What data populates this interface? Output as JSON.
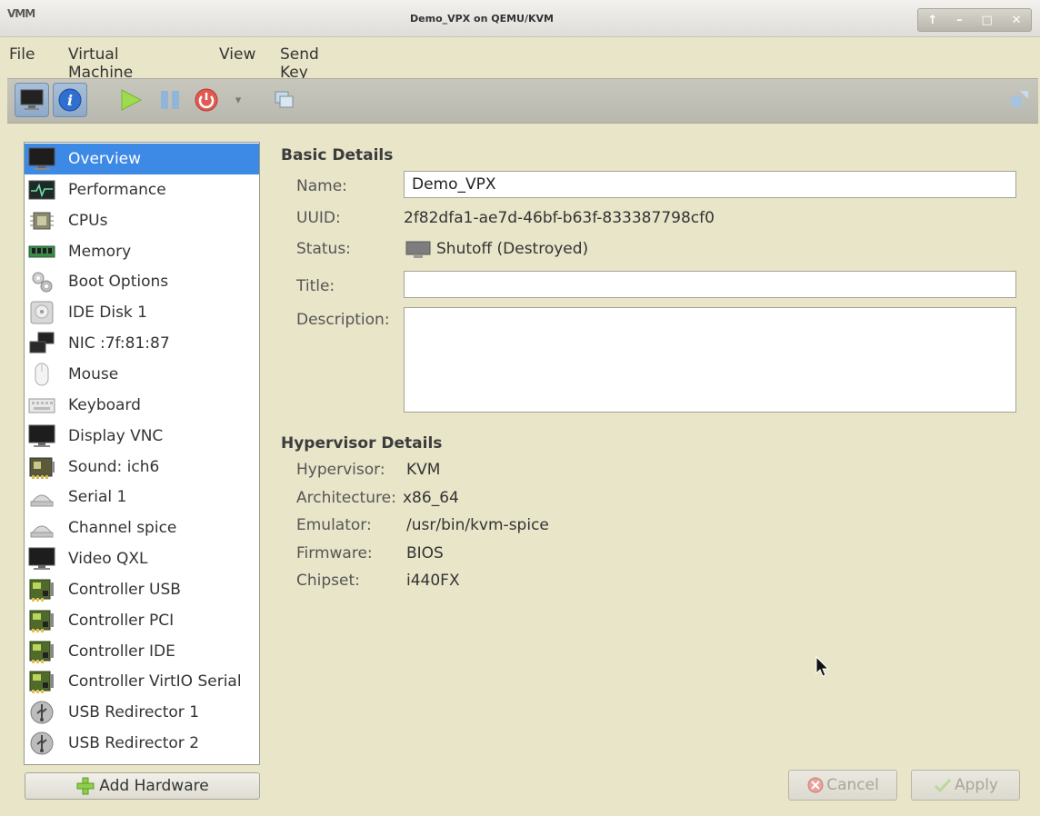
{
  "window": {
    "logo": "VMM",
    "title": "Demo_VPX on QEMU/KVM"
  },
  "menu": [
    "File",
    "Virtual Machine",
    "View",
    "Send Key"
  ],
  "toolbar": {
    "dropdown_glyph": "▾"
  },
  "hardware": [
    {
      "label": "Overview",
      "icon": "monitor-icon"
    },
    {
      "label": "Performance",
      "icon": "performance-icon"
    },
    {
      "label": "CPUs",
      "icon": "cpu-icon"
    },
    {
      "label": "Memory",
      "icon": "memory-icon"
    },
    {
      "label": "Boot Options",
      "icon": "gears-icon"
    },
    {
      "label": "IDE Disk 1",
      "icon": "disk-icon"
    },
    {
      "label": "NIC :7f:81:87",
      "icon": "network-icon"
    },
    {
      "label": "Mouse",
      "icon": "mouse-icon"
    },
    {
      "label": "Keyboard",
      "icon": "keyboard-icon"
    },
    {
      "label": "Display VNC",
      "icon": "monitor-icon"
    },
    {
      "label": "Sound: ich6",
      "icon": "sound-card-icon"
    },
    {
      "label": "Serial 1",
      "icon": "serial-icon"
    },
    {
      "label": "Channel spice",
      "icon": "serial-icon"
    },
    {
      "label": "Video QXL",
      "icon": "monitor-icon"
    },
    {
      "label": "Controller USB",
      "icon": "controller-card-icon"
    },
    {
      "label": "Controller PCI",
      "icon": "controller-card-icon"
    },
    {
      "label": "Controller IDE",
      "icon": "controller-card-icon"
    },
    {
      "label": "Controller VirtIO Serial",
      "icon": "controller-card-icon"
    },
    {
      "label": "USB Redirector 1",
      "icon": "usb-icon"
    },
    {
      "label": "USB Redirector 2",
      "icon": "usb-icon"
    }
  ],
  "add_hardware_label": "Add Hardware",
  "basic": {
    "title": "Basic Details",
    "name_label": "Name:",
    "name_value": "Demo_VPX",
    "uuid_label": "UUID:",
    "uuid_value": "2f82dfa1-ae7d-46bf-b63f-833387798cf0",
    "status_label": "Status:",
    "status_value": "Shutoff (Destroyed)",
    "title_label": "Title:",
    "title_value": "",
    "description_label": "Description:",
    "description_value": ""
  },
  "hypervisor": {
    "title": "Hypervisor Details",
    "rows": [
      {
        "label": "Hypervisor:",
        "value": "KVM"
      },
      {
        "label": "Architecture:",
        "value": "x86_64"
      },
      {
        "label": "Emulator:",
        "value": "/usr/bin/kvm-spice"
      },
      {
        "label": "Firmware:",
        "value": "BIOS"
      },
      {
        "label": "Chipset:",
        "value": "i440FX"
      }
    ]
  },
  "buttons": {
    "cancel": "Cancel",
    "apply": "Apply"
  },
  "colors": {
    "selection": "#3d89e6",
    "background": "#e8e5c8",
    "toolbar": "#bebdb3"
  }
}
